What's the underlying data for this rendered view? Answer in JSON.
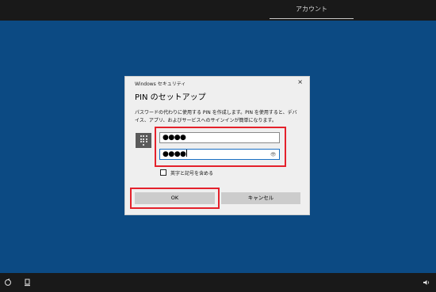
{
  "topbar": {
    "account_tab": "アカウント"
  },
  "dialog": {
    "caption": "Windows セキュリティ",
    "close_glyph": "×",
    "title": "PIN のセットアップ",
    "description": "パスワードの代わりに使用する PIN を作成します。PIN を使用すると、デバイス、アプリ、およびサービスへのサインインが簡単になります。",
    "pin_value": "●●●●",
    "confirm_pin_value": "●●●●",
    "checkbox_label": "英字と記号を含める",
    "checkbox_checked": false,
    "ok_label": "OK",
    "cancel_label": "キャンセル"
  },
  "bottombar": {
    "icons": [
      "ease-of-access-icon",
      "network-icon",
      "volume-icon"
    ]
  },
  "colors": {
    "background": "#0c4a83",
    "bar": "#191919",
    "dialog": "#efefef",
    "highlight": "#e4212b",
    "focus": "#1a6fc4"
  }
}
